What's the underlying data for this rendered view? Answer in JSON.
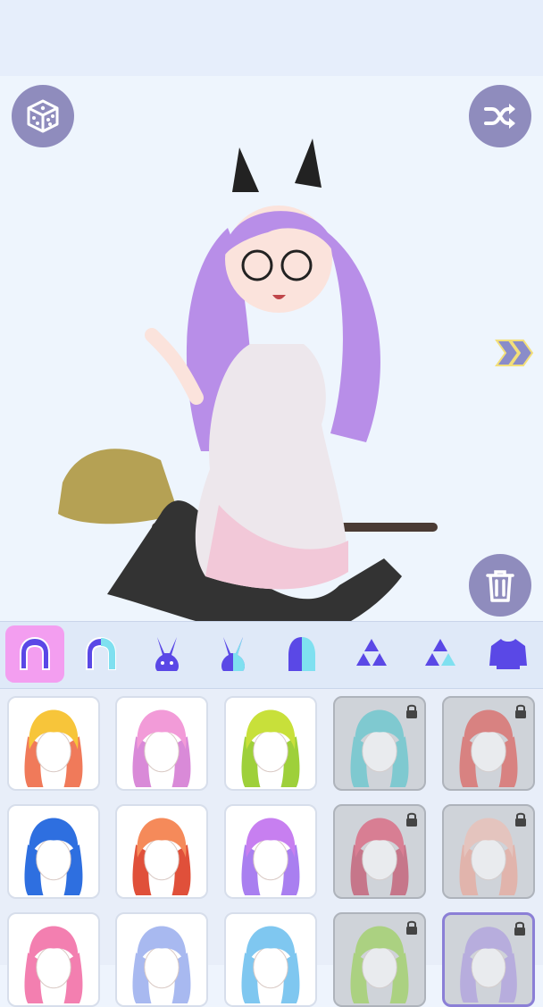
{
  "toolbar": {
    "random_icon": "dice-icon",
    "shuffle_icon": "shuffle-icon",
    "next_icon": "double-chevron-right-icon",
    "delete_icon": "trash-icon"
  },
  "categories": [
    {
      "name": "hair-full",
      "active": true
    },
    {
      "name": "hair-front"
    },
    {
      "name": "ears-bunny"
    },
    {
      "name": "ears-bunny-alt"
    },
    {
      "name": "hair-back"
    },
    {
      "name": "triforce"
    },
    {
      "name": "triforce-alt"
    },
    {
      "name": "top-sweater"
    }
  ],
  "hair_items": [
    {
      "color": "#f7c53a",
      "tip": "#f07a5a",
      "locked": false
    },
    {
      "color": "#f29bd8",
      "tip": "#d98ad8",
      "locked": false
    },
    {
      "color": "#c8e03a",
      "tip": "#9ed03a",
      "locked": false
    },
    {
      "color": "#3fc2c9",
      "tip": "#3fc2c9",
      "locked": true
    },
    {
      "color": "#e0403a",
      "tip": "#e0403a",
      "locked": true
    },
    {
      "color": "#2e6fe0",
      "tip": "#2e6fe0",
      "locked": false
    },
    {
      "color": "#f58a5a",
      "tip": "#e0503a",
      "locked": false
    },
    {
      "color": "#c77ff0",
      "tip": "#a97ff0",
      "locked": false
    },
    {
      "color": "#e03a5a",
      "tip": "#c02a4a",
      "locked": true
    },
    {
      "color": "#f6b9a8",
      "tip": "#f09c88",
      "locked": true
    },
    {
      "color": "#f37fb0",
      "tip": "#f37fb0",
      "locked": false
    },
    {
      "color": "#a8b9f0",
      "tip": "#a8b9f0",
      "locked": false
    },
    {
      "color": "#7fc7f0",
      "tip": "#7fc7f0",
      "locked": false
    },
    {
      "color": "#8fd03a",
      "tip": "#8fd03a",
      "locked": true
    },
    {
      "color": "#a58fe0",
      "tip": "#a58fe0",
      "locked": true,
      "selected": true
    }
  ],
  "colors": {
    "accent": "#f39ef0",
    "button": "#8f8cbd",
    "icon": "#5a48e6"
  }
}
